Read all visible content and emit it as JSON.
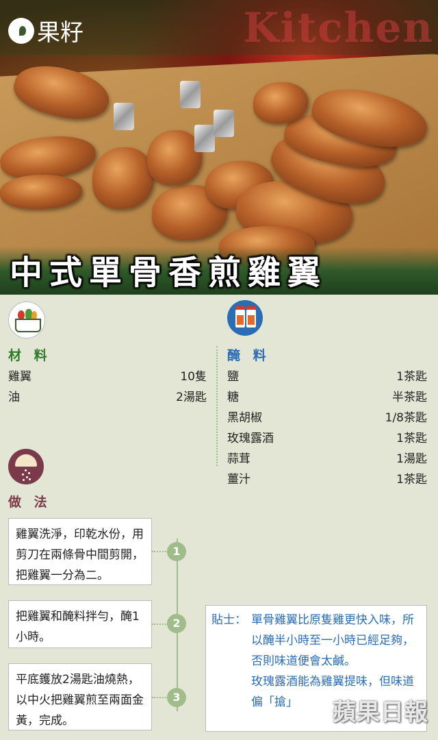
{
  "header": {
    "brand": "果籽",
    "kitchen_text": "Kitchen"
  },
  "dish_title": "中式單骨香煎雞翼",
  "ingredients": {
    "title": "材 料",
    "icon": "basket-icon",
    "items": [
      {
        "name": "雞翼",
        "amount": "10隻"
      },
      {
        "name": "油",
        "amount": "2湯匙"
      }
    ]
  },
  "marinade": {
    "title": "醃 料",
    "icon": "jar-icon",
    "items": [
      {
        "name": "鹽",
        "amount": "1茶匙"
      },
      {
        "name": "糖",
        "amount": "半茶匙"
      },
      {
        "name": "黑胡椒",
        "amount": "1/8茶匙"
      },
      {
        "name": "玫瑰露酒",
        "amount": "1茶匙"
      },
      {
        "name": "蒜茸",
        "amount": "1湯匙"
      },
      {
        "name": "薑汁",
        "amount": "1茶匙"
      }
    ]
  },
  "method": {
    "title": "做 法",
    "icon": "shaker-icon",
    "steps": [
      {
        "num": "1",
        "text": "雞翼洗淨，印乾水份，用剪刀在兩條骨中間剪開，把雞翼一分為二。"
      },
      {
        "num": "2",
        "text": "把雞翼和醃料拌勻，醃1小時。"
      },
      {
        "num": "3",
        "text": "平底鑊放2湯匙油燒熱，以中火把雞翼煎至兩面金黃，完成。"
      }
    ]
  },
  "tip": {
    "label": "貼士：",
    "paragraphs": [
      "單骨雞翼比原隻雞更快入味，所以醃半小時至一小時已經足夠，否則味道便會太鹹。",
      "玫瑰露酒能為雞翼提味，但味道偏「搶」"
    ]
  },
  "watermark": "蘋果日報",
  "colors": {
    "green": "#2f7a2a",
    "blue": "#2a6db5",
    "plum": "#7a3a4a",
    "sage": "#9fbc8a",
    "background": "#e3e6d5"
  }
}
